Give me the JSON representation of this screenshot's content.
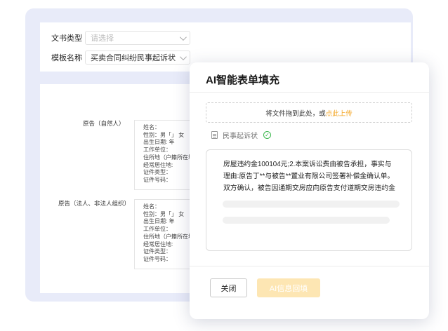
{
  "form": {
    "doc_type_label": "文书类型",
    "doc_type_placeholder": "请选择",
    "template_label": "模板名称",
    "template_value": "买卖合同纠纷民事起诉状"
  },
  "parties": [
    {
      "label": "原告（自然人）",
      "fields": [
        "姓名：",
        "性别：男「」  女",
        "出生日期:        年",
        "工作单位：",
        "住所地（户籍所在地）",
        "经常居住地:",
        "证件类型：",
        "证件号码："
      ]
    },
    {
      "label": "原告（法人、非法人组织）",
      "fields": [
        "姓名：",
        "性别：男「」  女",
        "出生日期:        年",
        "工作单位：",
        "住所地（户籍所在地）",
        "经常居住地:",
        "证件类型：",
        "证件号码："
      ]
    }
  ],
  "modal": {
    "title": "AI智能表单填充",
    "upload_text": "将文件拖到此处，或",
    "upload_link": "点此上传",
    "file_name": "民事起诉状",
    "content_lines": [
      "房屋违约金100104元;2.本案诉讼费由被告承担，事实与",
      "理由:原告丁**与被告**置业有限公司签署补偿金确认单。",
      "双方确认，被告因通期交房应向原告支付道期交房违约金"
    ],
    "close_button": "关闭",
    "fill_button": "AI信息回填"
  },
  "colors": {
    "accent": "#f4a623",
    "success": "#38b64a",
    "frame": "#e8ebf9",
    "disabled_button": "#fde6b3"
  }
}
